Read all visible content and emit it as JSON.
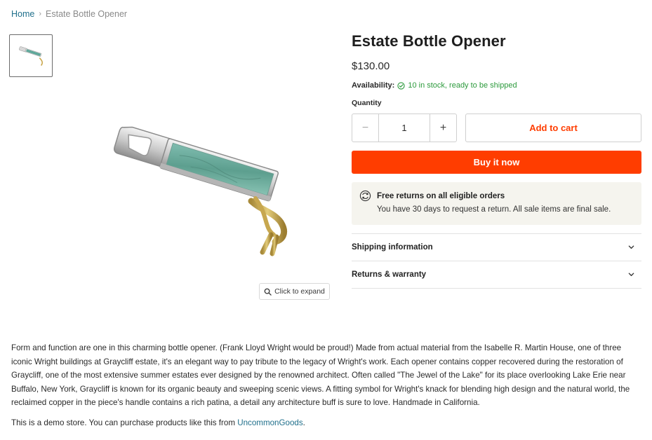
{
  "breadcrumb": {
    "home": "Home",
    "separator": "›",
    "current": "Estate Bottle Opener"
  },
  "product": {
    "title": "Estate Bottle Opener",
    "price": "$130.00",
    "image_icon": "bottle-opener-image",
    "expand_label": "Click to expand"
  },
  "availability": {
    "label": "Availability:",
    "value": "10 in stock, ready to be shipped",
    "color": "#2c9a3c"
  },
  "quantity": {
    "label": "Quantity",
    "value": "1",
    "minus": "−",
    "plus": "+"
  },
  "actions": {
    "add_to_cart": "Add to cart",
    "buy_now": "Buy it now",
    "accent_color": "#ff3d00"
  },
  "returns": {
    "title": "Free returns on all eligible orders",
    "text": "You have 30 days to request a return. All sale items are final sale."
  },
  "accordion": [
    {
      "label": "Shipping information"
    },
    {
      "label": "Returns & warranty"
    }
  ],
  "description": "Form and function are one in this charming bottle opener. (Frank Lloyd Wright would be proud!) Made from actual material from the Isabelle R. Martin House, one of three iconic Wright buildings at Graycliff estate, it's an elegant way to pay tribute to the legacy of Wright's work. Each opener contains copper recovered during the restoration of Graycliff, one of the most extensive summer estates ever designed by the renowned architect. Often called \"The Jewel of the Lake\" for its place overlooking Lake Erie near Buffalo, New York, Graycliff is known for its organic beauty and sweeping scenic views. A fitting symbol for Wright's knack for blending high design and the natural world, the reclaimed copper in the piece's handle contains a rich patina, a detail any architecture buff is sure to love. Handmade in California.",
  "demo": {
    "text": "This is a demo store. You can purchase products like this from ",
    "link": "UncommonGoods",
    "end": "."
  }
}
